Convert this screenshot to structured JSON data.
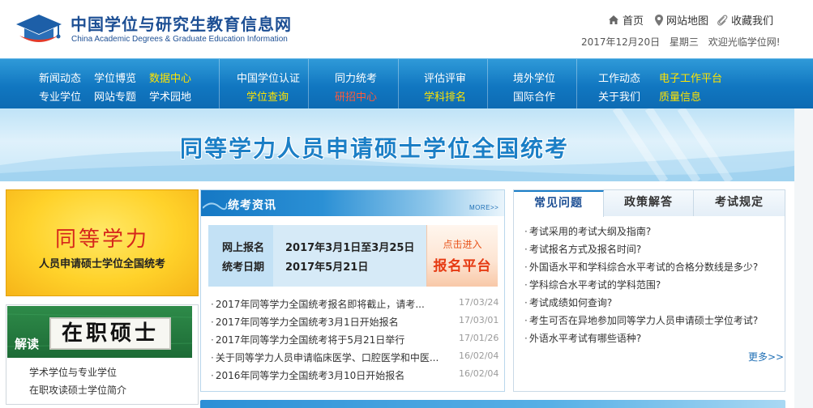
{
  "header": {
    "title_cn": "中国学位与研究生教育信息网",
    "title_en": "China Academic Degrees & Graduate Education Information",
    "links": {
      "home": "首页",
      "sitemap": "网站地图",
      "favorite": "收藏我们"
    },
    "date": "2017年12月20日",
    "weekday": "星期三",
    "welcome": "欢迎光临学位网!"
  },
  "nav": {
    "g1": {
      "a1": "新闻动态",
      "a2": "学位博览",
      "a3": "数据中心",
      "b1": "专业学位",
      "b2": "网站专题",
      "b3": "学术园地"
    },
    "g2": {
      "a": "中国学位认证",
      "b": "学位查询"
    },
    "g3": {
      "a": "同力统考",
      "b": "研招中心"
    },
    "g4": {
      "a": "评估评审",
      "b": "学科排名"
    },
    "g5": {
      "a": "境外学位",
      "b": "国际合作"
    },
    "g6": {
      "a1": "工作动态",
      "a2": "电子工作平台",
      "b1": "关于我们",
      "b2": "质量信息"
    }
  },
  "banner": {
    "title": "同等学力人员申请硕士学位全国统考"
  },
  "promo": {
    "title": "同等学力",
    "subtitle": "人员申请硕士学位全国统考"
  },
  "master": {
    "jiedu": "解读",
    "big": "在职硕士",
    "links": [
      "学术学位与专业学位",
      "在职攻读硕士学位简介"
    ]
  },
  "news": {
    "title": "统考资讯",
    "more": "MORE>>",
    "reg": {
      "label1": "网上报名",
      "value1": "2017年3月1日至3月25日",
      "label2": "统考日期",
      "value2": "2017年5月21日",
      "btn_top": "点击进入",
      "btn_main": "报名平台"
    },
    "items": [
      {
        "text": "2017年同等学力全国统考报名即将截止，请考...",
        "date": "17/03/24"
      },
      {
        "text": "2017年同等学力全国统考3月1日开始报名",
        "date": "17/03/01"
      },
      {
        "text": "2017年同等学力全国统考将于5月21日举行",
        "date": "17/01/26"
      },
      {
        "text": "关于同等学力人员申请临床医学、口腔医学和中医...",
        "date": "16/02/04"
      },
      {
        "text": "2016年同等学力全国统考3月10日开始报名",
        "date": "16/02/04"
      }
    ]
  },
  "faq": {
    "tabs": [
      "常见问题",
      "政策解答",
      "考试规定"
    ],
    "items": [
      "考试采用的考试大纲及指南?",
      "考试报名方式及报名时间?",
      "外国语水平和学科综合水平考试的合格分数线是多少?",
      "学科综合水平考试的学科范围?",
      "考试成绩如何查询?",
      "考生可否在异地参加同等学力人员申请硕士学位考试?",
      "外语水平考试有哪些语种?"
    ],
    "more": "更多>>"
  },
  "colors": {
    "brand_blue": "#1d4f94",
    "nav_blue": "#1177c1",
    "highlight_yellow": "#ffe400",
    "promo_red": "#d6261b"
  }
}
